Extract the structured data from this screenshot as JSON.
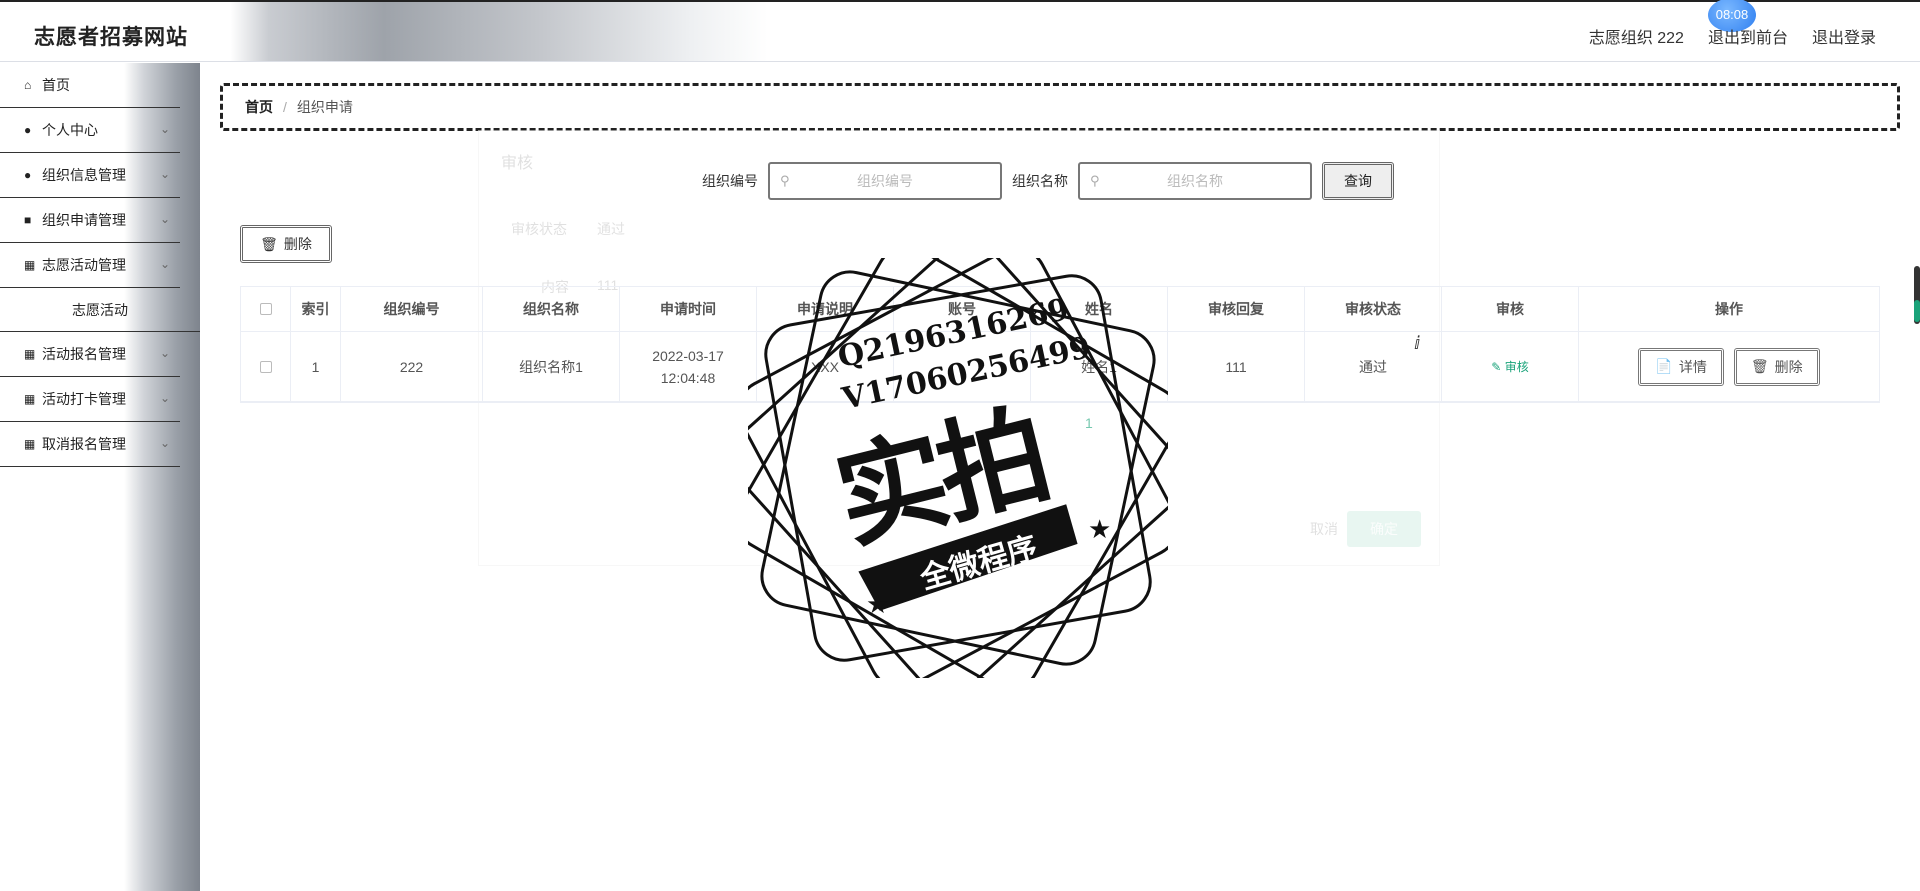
{
  "header": {
    "brand": "志愿者招募网站",
    "user": "志愿组织 222",
    "to_front": "退出到前台",
    "logout": "退出登录",
    "time_badge": "08:08"
  },
  "sidebar": {
    "items": [
      {
        "label": "首页",
        "icon": "home-icon",
        "expandable": false
      },
      {
        "label": "个人中心",
        "icon": "user-icon",
        "expandable": true
      },
      {
        "label": "组织信息管理",
        "icon": "user-icon",
        "expandable": true
      },
      {
        "label": "组织申请管理",
        "icon": "chat-icon",
        "expandable": true
      },
      {
        "label": "志愿活动管理",
        "icon": "grid-icon",
        "expandable": true
      },
      {
        "label": "志愿活动",
        "icon": "",
        "expandable": false,
        "sub": true
      },
      {
        "label": "活动报名管理",
        "icon": "grid-icon",
        "expandable": true
      },
      {
        "label": "活动打卡管理",
        "icon": "grid-icon",
        "expandable": true
      },
      {
        "label": "取消报名管理",
        "icon": "grid-icon",
        "expandable": true
      }
    ]
  },
  "breadcrumb": {
    "home": "首页",
    "separator": "/",
    "current": "组织申请"
  },
  "search": {
    "org_no_label": "组织编号",
    "org_no_placeholder": "组织编号",
    "org_name_label": "组织名称",
    "org_name_placeholder": "组织名称",
    "query_button": "查询"
  },
  "toolbar": {
    "delete_label": "删除"
  },
  "table": {
    "columns": [
      "索引",
      "组织编号",
      "组织名称",
      "申请时间",
      "申请说明",
      "账号",
      "姓名",
      "审核回复",
      "审核状态",
      "审核",
      "操作"
    ],
    "rows": [
      {
        "index": "1",
        "org_no": "222",
        "org_name": "组织名称1",
        "apply_time": "2022-03-17 12:04:48",
        "apply_desc": "XXX",
        "account": "",
        "name": "姓名1",
        "reply": "111",
        "status": "通过",
        "audit": "审核",
        "detail": "详情",
        "delete": "删除"
      }
    ]
  },
  "modal_ghost": {
    "title": "审核",
    "status_label": "审核状态",
    "status_value": "通过",
    "content_label": "内容",
    "content_value": "111",
    "page": "1",
    "cancel": "取消",
    "confirm": "确定"
  },
  "watermark": {
    "line1": "Q2196316269",
    "line2": "V17060256499",
    "main": "实拍",
    "banner": "全微程序"
  },
  "colors": {
    "accent": "#1aa37a",
    "badge": "#2f7ff0"
  }
}
